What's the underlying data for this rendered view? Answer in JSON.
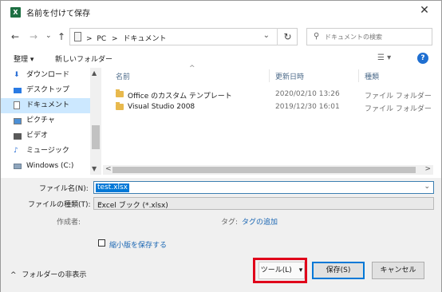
{
  "window": {
    "title": "名前を付けて保存",
    "app_icon": "X"
  },
  "nav": {
    "back": "←",
    "forward": "→",
    "recent": "⌄",
    "up": "↑",
    "crumb_pc": "PC",
    "crumb_sep": ">",
    "crumb_docs": "ドキュメント",
    "search_placeholder": "ドキュメントの検索"
  },
  "commandbar": {
    "organize": "整理 ▾",
    "new_folder": "新しいフォルダー"
  },
  "sidebar": {
    "items": [
      {
        "label": "ダウンロード",
        "icon": "download-icon"
      },
      {
        "label": "デスクトップ",
        "icon": "desktop-icon"
      },
      {
        "label": "ドキュメント",
        "icon": "documents-icon"
      },
      {
        "label": "ピクチャ",
        "icon": "pictures-icon"
      },
      {
        "label": "ビデオ",
        "icon": "videos-icon"
      },
      {
        "label": "ミュージック",
        "icon": "music-icon"
      },
      {
        "label": "Windows (C:)",
        "icon": "drive-icon"
      }
    ]
  },
  "file_list": {
    "columns": [
      "名前",
      "更新日時",
      "種類"
    ],
    "rows": [
      {
        "name": "Office のカスタム テンプレート",
        "modified": "2020/02/10 13:26",
        "type": "ファイル フォルダー"
      },
      {
        "name": "Visual Studio 2008",
        "modified": "2019/12/30 16:01",
        "type": "ファイル フォルダー"
      }
    ]
  },
  "form": {
    "filename_label": "ファイル名(N):",
    "filename_value": "test.xlsx",
    "filetype_label": "ファイルの種類(T):",
    "filetype_value": "Excel ブック (*.xlsx)",
    "author_label": "作成者:",
    "tags_label": "タグ:",
    "tags_link": "タグの追加",
    "thumbnail_label": "縮小版を保存する"
  },
  "footer": {
    "hide_folders": "フォルダーの非表示",
    "tools_button": "ツール(L)",
    "save_button": "保存(S)",
    "cancel_button": "キャンセル"
  },
  "colors": {
    "accent": "#0078d7",
    "highlight": "#e0001a",
    "selection": "#cce8ff"
  }
}
